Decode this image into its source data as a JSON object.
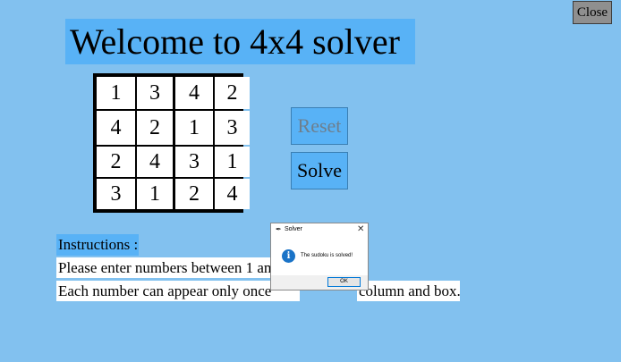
{
  "window": {
    "close_label": "Close",
    "title": "Welcome to 4x4 solver"
  },
  "grid": [
    [
      "1",
      "3",
      "4",
      "2"
    ],
    [
      "4",
      "2",
      "1",
      "3"
    ],
    [
      "2",
      "4",
      "3",
      "1"
    ],
    [
      "3",
      "1",
      "2",
      "4"
    ]
  ],
  "buttons": {
    "reset_label": "Reset",
    "solve_label": "Solve"
  },
  "instructions": {
    "heading": "Instructions :",
    "line1": "Please enter numbers between 1 and",
    "line2_left": "Each number can appear only once",
    "line2_right": "column and box."
  },
  "dialog": {
    "title": "Solver",
    "message": "The sudoku is solved!",
    "ok_label": "OK",
    "info_icon": "i",
    "close_glyph": "✕",
    "feather_icon": "✒"
  },
  "colors": {
    "background": "#82c1ef",
    "accent": "#58b2f6"
  }
}
